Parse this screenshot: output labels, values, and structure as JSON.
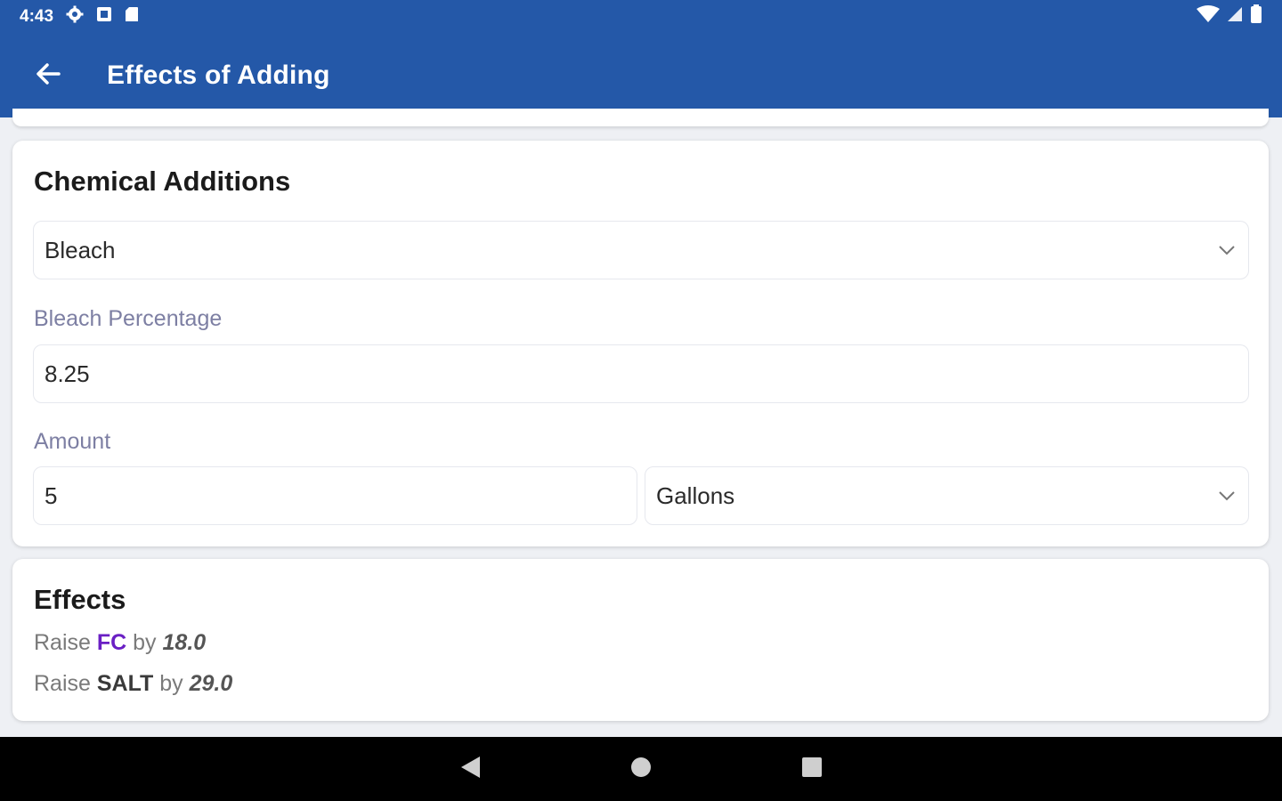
{
  "status_bar": {
    "time": "4:43",
    "left_icons": [
      "gear-icon",
      "notification-icon",
      "sd-card-icon"
    ],
    "right_icons": [
      "wifi-icon",
      "signal-icon",
      "battery-icon"
    ]
  },
  "app_bar": {
    "title": "Effects of Adding",
    "back_icon": "arrow-left-icon",
    "color": "#2458a8"
  },
  "chemical_additions": {
    "title": "Chemical Additions",
    "chemical_select": {
      "value": "Bleach"
    },
    "percentage": {
      "label": "Bleach Percentage",
      "value": "8.25"
    },
    "amount": {
      "label": "Amount",
      "value": "5"
    },
    "unit_select": {
      "value": "Gallons"
    }
  },
  "effects": {
    "title": "Effects",
    "items": [
      {
        "verb": "Raise",
        "chemical": "FC",
        "by": "by",
        "amount": "18.0",
        "chemical_color": "#6a1fc4"
      },
      {
        "verb": "Raise",
        "chemical": "SALT",
        "by": "by",
        "amount": "29.0",
        "chemical_color": "#3a3a3a"
      }
    ]
  },
  "nav_bar": {
    "buttons": [
      "back-triangle-icon",
      "home-circle-icon",
      "recents-square-icon"
    ]
  }
}
